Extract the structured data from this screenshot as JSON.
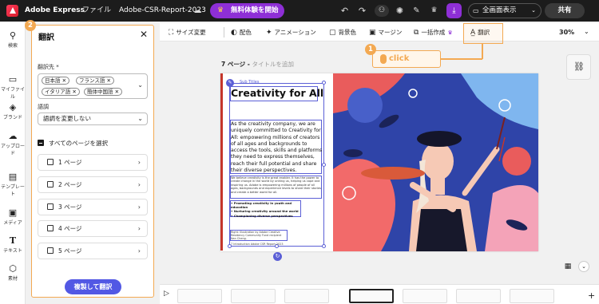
{
  "header": {
    "app_name": "Adobe Express",
    "file_menu": "ファイル",
    "doc_name": "Adobe-CSR-Report-2023",
    "trial_button": "無料体験を開始",
    "present_button": "全画面表示",
    "share_button": "共有"
  },
  "rail": {
    "items": [
      {
        "label": "検索",
        "icon": "search-icon"
      },
      {
        "label": "マイファイル",
        "icon": "folder-icon"
      },
      {
        "label": "ブランド",
        "icon": "brand-icon"
      },
      {
        "label": "アップロード",
        "icon": "upload-icon"
      },
      {
        "label": "テンプレート",
        "icon": "template-icon"
      },
      {
        "label": "メディア",
        "icon": "media-icon"
      },
      {
        "label": "テキスト",
        "icon": "text-icon"
      },
      {
        "label": "素材",
        "icon": "elements-icon"
      }
    ]
  },
  "panel": {
    "title": "翻訳",
    "target_label": "翻訳先 *",
    "languages": [
      "日本語",
      "フランス語",
      "イタリア語",
      "簡体中国語"
    ],
    "tone_label": "語調",
    "tone_value": "語調を変更しない",
    "select_all": "すべてのページを選択",
    "pages": [
      "1 ページ",
      "2 ページ",
      "3 ページ",
      "4 ページ",
      "5 ページ"
    ],
    "translate_button": "複製して翻訳",
    "step_badge": "2"
  },
  "toolbar": {
    "resize": "サイズ変更",
    "color": "配色",
    "animation": "アニメーション",
    "background": "背景色",
    "margin": "マージン",
    "bulk": "一括作成",
    "translate": "翻訳",
    "zoom": "30%"
  },
  "callout": {
    "step_badge": "1",
    "text": "click"
  },
  "canvas": {
    "page_label": "7 ページ - ",
    "page_title_placeholder": "タイトルを追加",
    "doc_tag": "Sub Titles",
    "doc_title": "Creativity for All",
    "doc_paragraph": "As the creativity company, we are uniquely committed to Creativity for All: empowering millions of creators of all ages and backgrounds to access the tools, skills and platforms they need to express themselves, reach their full potential and share their diverse perspectives.",
    "doc_small": "We believe creativity is the great enabler. It has the power to create change in the world by uniting us, helping us cope and inspiring us. Adobe is empowering millions of people of all ages, backgrounds and experience levels to share their stories and create a better world for all.",
    "doc_bullets": [
      "Promoting creativity in youth and education",
      "Nurturing creativity around the world",
      "Championing diverse perspectives"
    ],
    "doc_credit": "Right: Illustration by Adobe Creative Residency Community Fund recipient Nan Cheng.",
    "doc_footer": "7 Introduction  Adobe CSR Report 2023"
  },
  "colors": {
    "accent": "#5b5fd6",
    "callout": "#f3a952",
    "brand_purple": "#8e2fd6",
    "topbar": "#1c1c1c"
  }
}
